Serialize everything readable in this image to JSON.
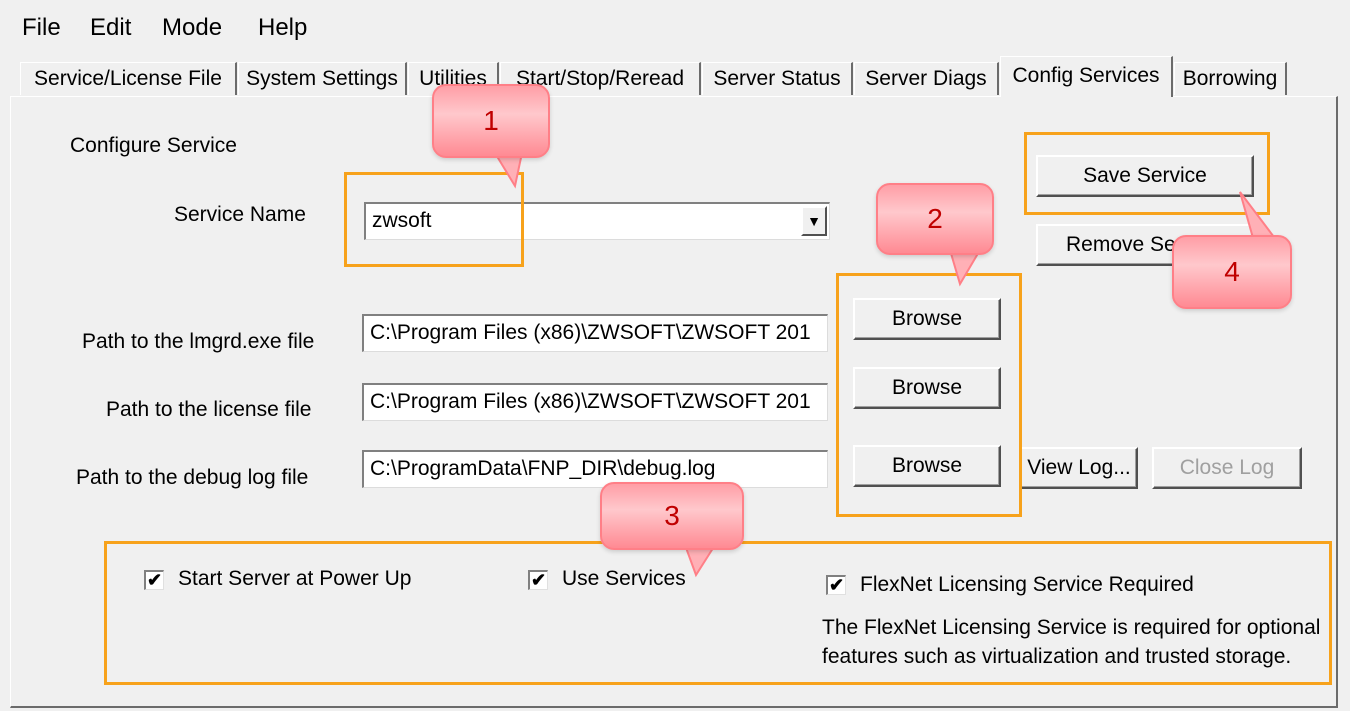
{
  "menu": [
    "File",
    "Edit",
    "Mode",
    "Help"
  ],
  "tabs": [
    {
      "label": "Service/License File",
      "active": false
    },
    {
      "label": "System Settings",
      "active": false
    },
    {
      "label": "Utilities",
      "active": false
    },
    {
      "label": "Start/Stop/Reread",
      "active": false
    },
    {
      "label": "Server Status",
      "active": false
    },
    {
      "label": "Server Diags",
      "active": false
    },
    {
      "label": "Config Services",
      "active": true
    },
    {
      "label": "Borrowing",
      "active": false
    }
  ],
  "section_title": "Configure Service",
  "service_name": {
    "label": "Service Name",
    "value": "zwsoft"
  },
  "lmgrd_path": {
    "label": "Path to the lmgrd.exe file",
    "value": "C:\\Program Files (x86)\\ZWSOFT\\ZWSOFT 201"
  },
  "license_path": {
    "label": "Path to the license file",
    "value": "C:\\Program Files (x86)\\ZWSOFT\\ZWSOFT 201"
  },
  "debug_path": {
    "label": "Path to the debug log file",
    "value": "C:\\ProgramData\\FNP_DIR\\debug.log"
  },
  "buttons": {
    "save_service": "Save Service",
    "remove_service": "Remove Se",
    "browse": "Browse",
    "view_log": "View Log...",
    "close_log": "Close Log"
  },
  "options": {
    "start_server": {
      "label": "Start Server at Power Up",
      "checked": true
    },
    "use_services": {
      "label": "Use Services",
      "checked": true
    },
    "flexnet_required": {
      "label": "FlexNet Licensing Service Required",
      "checked": true
    },
    "flexnet_note_line1": "The FlexNet Licensing Service is required for optional",
    "flexnet_note_line2": "features such as virtualization and trusted storage."
  },
  "callouts": [
    "1",
    "2",
    "3",
    "4"
  ],
  "check_glyph": "✔",
  "dropdown_glyph": "▼",
  "colors": {
    "highlight": "#f7a21b",
    "callout_text": "#c00000"
  }
}
